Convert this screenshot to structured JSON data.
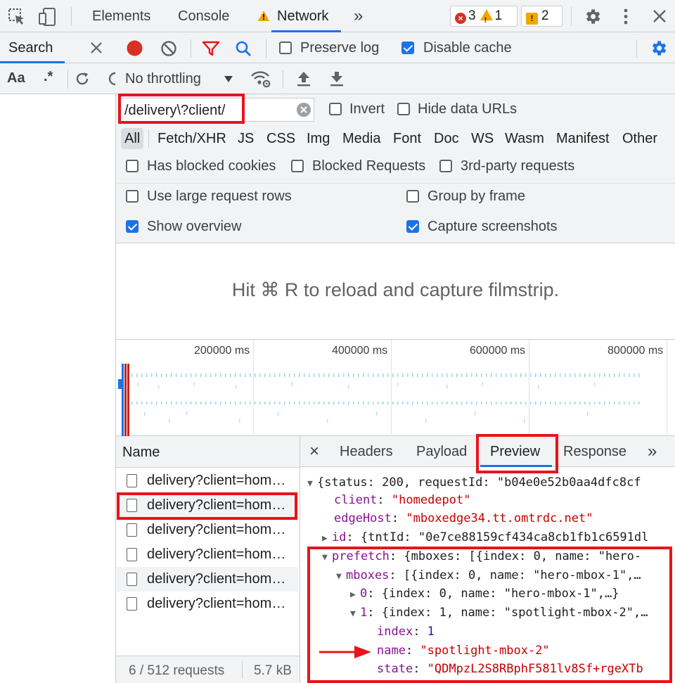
{
  "tabs": {
    "elements": "Elements",
    "console": "Console",
    "network": "Network",
    "more": "»"
  },
  "badges": {
    "errors": "3",
    "warnings": "1",
    "issues": "2"
  },
  "search_panel": {
    "title": "Search",
    "case_label": "Aa",
    "regex_label": ".*"
  },
  "toolbar": {
    "preserve_log": "Preserve log",
    "disable_cache": "Disable cache",
    "throttling": "No throttling"
  },
  "filter": {
    "value": "/delivery\\?client/",
    "invert": "Invert",
    "hide_data_urls": "Hide data URLs",
    "types": [
      "All",
      "Fetch/XHR",
      "JS",
      "CSS",
      "Img",
      "Media",
      "Font",
      "Doc",
      "WS",
      "Wasm",
      "Manifest",
      "Other"
    ],
    "has_blocked_cookies": "Has blocked cookies",
    "blocked_requests": "Blocked Requests",
    "third_party": "3rd-party requests"
  },
  "settings": {
    "large_rows": "Use large request rows",
    "group_by_frame": "Group by frame",
    "show_overview": "Show overview",
    "capture_screenshots": "Capture screenshots"
  },
  "filmstrip": {
    "message": "Hit ⌘ R to reload and capture filmstrip."
  },
  "overview": {
    "ticks": [
      "200000 ms",
      "400000 ms",
      "600000 ms",
      "800000 ms"
    ]
  },
  "requests": {
    "header": "Name",
    "rows": [
      "delivery?client=homedepot",
      "delivery?client=homedepot",
      "delivery?client=homedepot",
      "delivery?client=homedepot",
      "delivery?client=homedepot",
      "delivery?client=homedepot"
    ],
    "footer_count": "6 / 512 requests",
    "footer_size": "5.7 kB"
  },
  "detail_tabs": {
    "close": "×",
    "headers": "Headers",
    "payload": "Payload",
    "preview": "Preview",
    "response": "Response",
    "more": "»"
  },
  "preview": {
    "l1": "{status: 200, requestId: \"b04e0e52b0aa4dfc8cf",
    "l2_key": "client",
    "l2_val": "\"homedepot\"",
    "l3_key": "edgeHost",
    "l3_val": "\"mboxedge34.tt.omtrdc.net\"",
    "l4_key": "id",
    "l4_val": "{tntId: \"0e7ce88159cf434ca8cb1fb1c6591dl",
    "l5_key": "prefetch",
    "l5_val": "{mboxes: [{index: 0, name: \"hero-",
    "l6_key": "mboxes",
    "l6_val": "[{index: 0, name: \"hero-mbox-1\",…",
    "l7_key": "0",
    "l7_val": "{index: 0, name: \"hero-mbox-1\",…}",
    "l8_key": "1",
    "l8_val": "{index: 1, name: \"spotlight-mbox-2\",…",
    "l9_key": "index",
    "l9_val": "1",
    "l10_key": "name",
    "l10_val": "\"spotlight-mbox-2\"",
    "l11_key": "state",
    "l11_val": "\"QDMpzL2S8RBphF581lv8Sf+rgeXTb"
  },
  "colors": {
    "accent": "#1a73e8",
    "annotation_red": "#e8141b",
    "record_red": "#d93025"
  }
}
